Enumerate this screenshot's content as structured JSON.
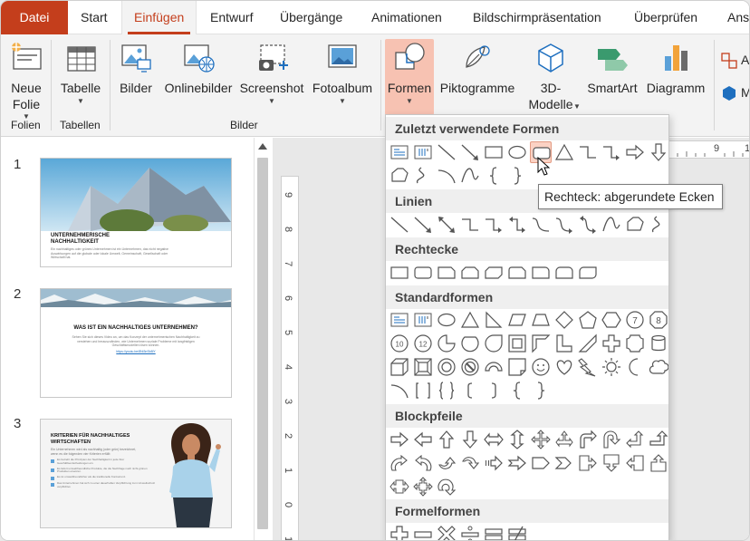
{
  "tabs": [
    "Datei",
    "Start",
    "Einfügen",
    "Entwurf",
    "Übergänge",
    "Animationen",
    "Bildschirmpräsentation",
    "Überprüfen",
    "Ans"
  ],
  "active_tab": "Einfügen",
  "ribbon": {
    "new_slide": [
      "Neue",
      "Folie"
    ],
    "table": "Tabelle",
    "pictures": "Bilder",
    "online_pictures": "Onlinebilder",
    "screenshot": "Screenshot",
    "photo_album": "Fotoalbum",
    "shapes": "Formen",
    "icons": "Piktogramme",
    "models": [
      "3D-",
      "Modelle"
    ],
    "smartart": "SmartArt",
    "chart": "Diagramm",
    "add_letter": "A",
    "m_letter": "M",
    "groups": {
      "folien": "Folien",
      "tabellen": "Tabellen",
      "bilder": "Bilder"
    }
  },
  "slides": [
    {
      "number": "1",
      "title": "UNTERNEHMERISCHE NACHHALTIGKEIT",
      "body": "Ein nachhaltiges oder grünes Unternehmen ist ein Unternehmen, das nicht negative Auswirkungen auf die globale oder lokale Umwelt, Gemeinschaft, Gesellschaft oder Wirtschaft hat."
    },
    {
      "number": "2",
      "title": "WAS IST EIN NACHHALTIGES UNTERNEHMEN?",
      "body": "Sehen Sie sich dieses Video an, um das Konzept der unternehmerischen Nachhaltigkeit zu verstehen und herauszufinden, wie Unternehmen soziale Probleme mit langfristigen Geschäftsmodellen lösen können.",
      "link": "https://youtu.be/8Ni3nSb8lY"
    },
    {
      "number": "3",
      "title": "KRITERIEN FÜR NACHHALTIGES WIRTSCHAFTEN",
      "body": "Ein Unternehmen wird als nachhaltig (oder grün) bezeichnet, wenn es die folgenden vier Kriterien erfüllt:",
      "bullets": [
        "Es bezieht die Prinzipien der Nachhaltigkeit in jede ihrer Geschäftsentscheidungen ein.",
        "Es liefert umweltfreundliche Produkte, die die Nachfrage nach nicht-grünen Produkten ersetzen.",
        "Es ist umweltfreundlicher als die traditionelle Konkurrenz.",
        "Das Unternehmen hat sich zu einer dauerhaften Verpflichtung zum Umweltschutz verpflichtet."
      ]
    }
  ],
  "ruler_h": [
    "9",
    "1"
  ],
  "ruler_v": [
    "9",
    "8",
    "7",
    "6",
    "5",
    "4",
    "3",
    "2",
    "1",
    "0",
    "1"
  ],
  "shapes_menu": {
    "sections": [
      "Zuletzt verwendete Formen",
      "Linien",
      "Rechtecke",
      "Standardformen",
      "Blockpfeile",
      "Formelformen"
    ],
    "recent": [
      "text-box",
      "vertical-text-box",
      "line",
      "arrow-line",
      "rectangle",
      "oval",
      "rounded-rectangle",
      "triangle",
      "elbow-connector",
      "elbow-arrow-connector",
      "right-arrow",
      "down-arrow",
      "freeform",
      "scribble",
      "arc",
      "curve",
      "left-brace",
      "right-brace"
    ],
    "lines": [
      "line",
      "arrow-line",
      "double-arrow-line",
      "elbow-connector",
      "elbow-arrow-connector",
      "elbow-double-arrow",
      "curved-connector",
      "curved-arrow-connector",
      "curved-double-arrow",
      "curve",
      "freeform",
      "scribble"
    ],
    "rectangles": [
      "rectangle",
      "rounded-rectangle",
      "snip-single-corner",
      "snip-same-side",
      "snip-diagonal",
      "snip-round-corner",
      "round-single-corner",
      "round-same-side",
      "round-diagonal"
    ],
    "basic": [
      "text-box",
      "vertical-text-box",
      "oval",
      "triangle",
      "right-triangle",
      "parallelogram",
      "trapezoid",
      "diamond",
      "pentagon",
      "hexagon",
      "heptagon",
      "octagon",
      "decagon",
      "dodecagon",
      "pie",
      "chord",
      "teardrop",
      "frame",
      "half-frame",
      "l-shape",
      "diagonal-stripe",
      "cross",
      "plaque",
      "can",
      "cube",
      "bevel",
      "donut",
      "no-symbol",
      "block-arc",
      "folded-corner",
      "smiley",
      "heart",
      "lightning",
      "sun",
      "moon",
      "cloud",
      "arc",
      "double-bracket",
      "double-brace",
      "left-bracket",
      "right-bracket",
      "left-brace",
      "right-brace"
    ],
    "block_arrows": [
      "right-arrow",
      "left-arrow",
      "up-arrow",
      "down-arrow",
      "left-right-arrow",
      "up-down-arrow",
      "quad-arrow",
      "left-right-up-arrow",
      "bent-arrow",
      "u-turn-arrow",
      "left-up-arrow",
      "bent-up-arrow",
      "curved-right-arrow",
      "curved-left-arrow",
      "curved-up-arrow",
      "curved-down-arrow",
      "striped-right-arrow",
      "notched-right-arrow",
      "pentagon-arrow",
      "chevron",
      "right-arrow-callout",
      "down-arrow-callout",
      "left-arrow-callout",
      "up-arrow-callout",
      "left-right-arrow-callout",
      "quad-arrow-callout",
      "circular-arrow"
    ],
    "equation": [
      "plus",
      "minus",
      "multiply",
      "divide",
      "equal",
      "not-equal"
    ],
    "number_labels": [
      "7",
      "8",
      "10",
      "12"
    ]
  },
  "tooltip": "Rechteck: abgerundete Ecken",
  "colors": {
    "accent": "#c43e1c",
    "selected": "#f7c2b2"
  }
}
